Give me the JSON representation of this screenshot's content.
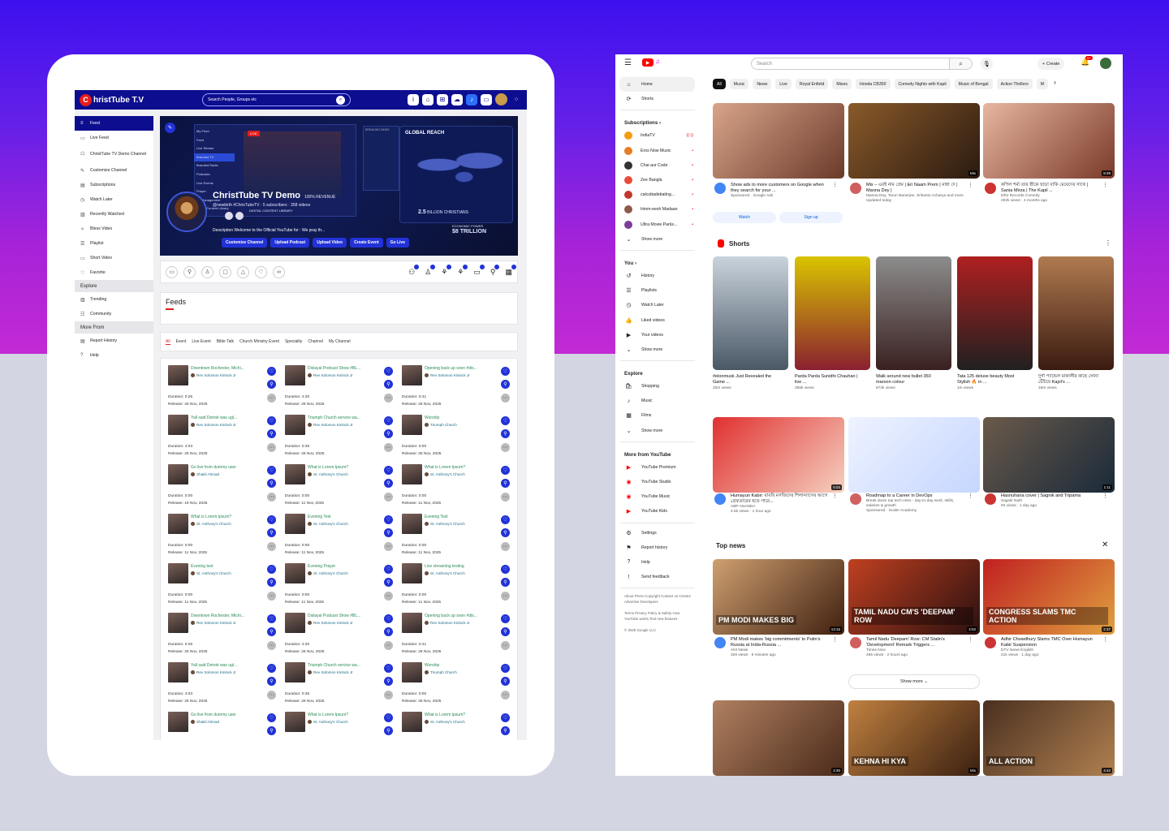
{
  "christtube": {
    "logo_letter": "C",
    "logo_text": "hristTube T.V",
    "search_placeholder": "Search People, Groups etc",
    "sidebar": {
      "items": [
        {
          "icon": "≡",
          "label": "Feed"
        },
        {
          "icon": "▭",
          "label": "Live Feed"
        },
        {
          "icon": "☖",
          "label": "ChristTube TV Demo Channel"
        },
        {
          "icon": "✎",
          "label": "Customize Channel"
        },
        {
          "icon": "▤",
          "label": "Subscriptions"
        },
        {
          "icon": "◷",
          "label": "Watch Later"
        },
        {
          "icon": "▥",
          "label": "Recently Watched"
        },
        {
          "icon": "✧",
          "label": "Bless Video"
        },
        {
          "icon": "☰",
          "label": "Playlist"
        },
        {
          "icon": "▭",
          "label": "Short Video"
        },
        {
          "icon": "♡",
          "label": "Favorite"
        }
      ],
      "explore_heading": "Explore",
      "explore_items": [
        {
          "icon": "▥",
          "label": "Trending"
        },
        {
          "icon": "☷",
          "label": "Community"
        }
      ],
      "more_heading": "More From",
      "more_items": [
        {
          "icon": "▤",
          "label": "Report History"
        },
        {
          "icon": "?",
          "label": "Help"
        }
      ]
    },
    "banner": {
      "menu": [
        "My Feed",
        "Feed",
        "Live Stream",
        "Branded TV",
        "Branded Radio",
        "Podcasts",
        "Live Events",
        "Prayer",
        "Ad Management",
        "Digital Content Library"
      ],
      "live": "LIVE",
      "breaking": "BREAKING NEWS",
      "global": "GLOBAL REACH",
      "revenue": "100% REVENUE",
      "stat1_value": "2.5",
      "stat1_label": "BILLION CHRISTIANS",
      "stat2_value": "$8 TRILLION",
      "stat2_label": "ECONOMIC POWER",
      "channel_title": "ChristTube TV Demo",
      "channel_sub": "@newbirth  #ChrisTubeTV · 5 subscribers · 358 videos",
      "library": "DIGITAL CONTENT LIBRARY",
      "description": "Description Welcome to the Official YouTube for : We pray th...",
      "buttons": [
        "Customize Channel",
        "Upload Podcast",
        "Upload Video",
        "Create Event",
        "Go Live"
      ]
    },
    "feeds_title": "Feeds",
    "tabs": [
      "All",
      "Event",
      "Live Event",
      "Bible Talk",
      "Church Ministry Event",
      "Speciality",
      "Channel",
      "My Channel"
    ],
    "cards": [
      {
        "title": "Downtown Rochester, Michi...",
        "author": "Rev Solomon Kinlock Jr",
        "duration": "Duration: 0:26",
        "release": "Release: 26 Nov, 2025"
      },
      {
        "title": "Dislayal Podcast Show #BL...",
        "author": "Rev Solomon Kinlock Jr",
        "duration": "Duration: 4:20",
        "release": "Release: 26 Nov, 2025"
      },
      {
        "title": "Opening back up soon #dis...",
        "author": "Rev Solomon Kinlock Jr",
        "duration": "Duration: 0:41",
        "release": "Release: 26 Nov, 2025"
      },
      {
        "title": "Yall said Detroit was ugl...",
        "author": "Rev Solomon Kinlock Jr",
        "duration": "Duration: 4:03",
        "release": "Release: 26 Nov, 2025"
      },
      {
        "title": "Triumph Church service wa...",
        "author": "Rev Solomon Kinlock Jr",
        "duration": "Duration: 0:36",
        "release": "Release: 26 Nov, 2025"
      },
      {
        "title": "Worship",
        "author": "Triumph Church",
        "duration": "Duration: 0:00",
        "release": "Release: 25 Nov, 2025"
      },
      {
        "title": "Go live from dummy user",
        "author": "Shakil Ahmad",
        "duration": "Duration: 0:00",
        "release": "Release: 19 Nov, 2025"
      },
      {
        "title": "What is Lorem Ipsum?",
        "author": "St. Anthony's Church",
        "duration": "Duration: 0:00",
        "release": "Release: 11 Nov, 2025"
      },
      {
        "title": "What is Lorem Ipsum?",
        "author": "St. Anthony's Church",
        "duration": "Duration: 0:00",
        "release": "Release: 11 Nov, 2025"
      },
      {
        "title": "What is Lorem Ipsum?",
        "author": "St. Anthony's Church",
        "duration": "Duration: 0:00",
        "release": "Release: 11 Nov, 2025"
      },
      {
        "title": "Evening Test",
        "author": "St. Anthony's Church",
        "duration": "Duration: 0:00",
        "release": "Release: 11 Nov, 2025"
      },
      {
        "title": "Evening Test",
        "author": "St. Anthony's Church",
        "duration": "Duration: 0:00",
        "release": "Release: 11 Nov, 2025"
      },
      {
        "title": "Evening test",
        "author": "St. Anthony's Church",
        "duration": "Duration: 0:00",
        "release": "Release: 11 Nov, 2025"
      },
      {
        "title": "Evening Prayer",
        "author": "St. Anthony's Church",
        "duration": "Duration: 0:00",
        "release": "Release: 11 Nov, 2025"
      },
      {
        "title": "Live streaming testing",
        "author": "St. Anthony's Church",
        "duration": "Duration: 0:00",
        "release": "Release: 11 Nov, 2025"
      },
      {
        "title": "Downtown Rochester, Michi...",
        "author": "Rev Solomon Kinlock Jr",
        "duration": "Duration: 0:26",
        "release": "Release: 26 Nov, 2025"
      },
      {
        "title": "Dislayal Podcast Show #BL...",
        "author": "Rev Solomon Kinlock Jr",
        "duration": "Duration: 4:20",
        "release": "Release: 26 Nov, 2025"
      },
      {
        "title": "Opening back up soon #dis...",
        "author": "Rev Solomon Kinlock Jr",
        "duration": "Duration: 0:41",
        "release": "Release: 26 Nov, 2025"
      },
      {
        "title": "Yall said Detroit was ugl...",
        "author": "Rev Solomon Kinlock Jr",
        "duration": "Duration: 4:03",
        "release": "Release: 26 Nov, 2025"
      },
      {
        "title": "Triumph Church service wa...",
        "author": "Rev Solomon Kinlock Jr",
        "duration": "Duration: 0:36",
        "release": "Release: 26 Nov, 2025"
      },
      {
        "title": "Worship",
        "author": "Triumph Church",
        "duration": "Duration: 0:00",
        "release": "Release: 25 Nov, 2025"
      },
      {
        "title": "Go live from dummy user",
        "author": "Shakil Ahmad",
        "duration": "",
        "release": ""
      },
      {
        "title": "What is Lorem Ipsum?",
        "author": "St. Anthony's Church",
        "duration": "",
        "release": ""
      },
      {
        "title": "What is Lorem Ipsum?",
        "author": "St. Anthony's Church",
        "duration": "",
        "release": ""
      }
    ]
  },
  "youtube": {
    "search_placeholder": "Search",
    "create_label": "+ Create",
    "bell_badge": "9+",
    "chips": [
      "All",
      "Music",
      "News",
      "Live",
      "Royal Enfield",
      "Mixes",
      "Honda CB350",
      "Comedy Nights with Kapil",
      "Music of Bengal",
      "Action Thrillers",
      "M"
    ],
    "sidebar": {
      "top": [
        {
          "icon": "⌂",
          "label": "Home"
        },
        {
          "icon": "⟳",
          "label": "Shorts"
        }
      ],
      "subs_heading": "Subscriptions  ›",
      "subs": [
        {
          "label": "IndiaTV",
          "color": "#f39c12",
          "live": "((·))"
        },
        {
          "label": "Eros Now Music",
          "color": "#e67e22",
          "live": "•"
        },
        {
          "label": "Chai aur Code",
          "color": "#333333",
          "live": "•"
        },
        {
          "label": "Zee Bangla",
          "color": "#e74c3c",
          "live": "•"
        },
        {
          "label": "calcuttadebating...",
          "color": "#c0392b",
          "live": "•"
        },
        {
          "label": "Hmm-eesh Madaan",
          "color": "#8e5a4a",
          "live": "•"
        },
        {
          "label": "Ultra Movie Parks...",
          "color": "#7d3c98",
          "live": "•"
        },
        {
          "label": "Show more",
          "color": "",
          "live": ""
        }
      ],
      "you_heading": "You  ›",
      "you": [
        {
          "icon": "↺",
          "label": "History"
        },
        {
          "icon": "☰",
          "label": "Playlists"
        },
        {
          "icon": "◷",
          "label": "Watch Later"
        },
        {
          "icon": "👍",
          "label": "Liked videos"
        },
        {
          "icon": "▶",
          "label": "Your videos"
        },
        {
          "icon": "⌄",
          "label": "Show more"
        }
      ],
      "explore_heading": "Explore",
      "explore": [
        {
          "icon": "🛍",
          "label": "Shopping"
        },
        {
          "icon": "♪",
          "label": "Music"
        },
        {
          "icon": "▦",
          "label": "Films"
        },
        {
          "icon": "⌄",
          "label": "Show more"
        }
      ],
      "more_heading": "More from YouTube",
      "more": [
        {
          "icon": "▶",
          "label": "YouTube Premium"
        },
        {
          "icon": "◉",
          "label": "YouTube Studio"
        },
        {
          "icon": "◉",
          "label": "YouTube Music"
        },
        {
          "icon": "▶",
          "label": "YouTube Kids"
        }
      ],
      "settings": [
        {
          "icon": "⚙",
          "label": "Settings"
        },
        {
          "icon": "⚑",
          "label": "Report history"
        },
        {
          "icon": "?",
          "label": "Help"
        },
        {
          "icon": "!",
          "label": "Send feedback"
        }
      ],
      "footer1": "About  Press  Copyright  Contact us  Creator  Advertise  Developers",
      "footer2": "Terms  Privacy  Policy & Safety  How YouTube works  Test new features",
      "copyright": "© 2025 Google LLC"
    },
    "row1": [
      {
        "title": "Show ads to more customers on Google when they search for your ...",
        "meta1": "Sponsored · Google Ads",
        "meta2": "",
        "dur": "",
        "bg": "linear-gradient(135deg,#d8a48a,#6b3a2a)"
      },
      {
        "title": "Mix – এরই নাম প্রেম | Eri Naam Prem | মান্না দে | Manna Dey |",
        "meta1": "Manna Dey, Tarun Banerjee, Srikanto Acharya and more",
        "meta2": "Updated today",
        "dur": "Mix",
        "bg": "linear-gradient(135deg,#8a5a2a,#2a1a10)"
      },
      {
        "title": "কপিল শর্মা তার স্ত্রীকে ছাড়া বাকি মেয়েদের সাথে | Sania Mirza | The Kapil ...",
        "meta1": "DRJ Records Comedy",
        "meta2": "292k views · 4 months ago",
        "dur": "8:39",
        "bg": "linear-gradient(135deg,#e7b6a0,#7a3a2a)"
      }
    ],
    "ad_buttons": [
      "Watch",
      "Sign up"
    ],
    "shorts_heading": "Shorts",
    "shorts": [
      {
        "title": "#elonmusk  Just Revealed the Game ...",
        "meta": "32m views",
        "bg": "linear-gradient(180deg,#c9d3dc,#4a5866)"
      },
      {
        "title": "Parda Parda Sunidhi Chauhan | live ...",
        "meta": "356k views",
        "bg": "linear-gradient(180deg,#d9c400,#8a2030)"
      },
      {
        "title": "Walk around new bullet 350 maroon colour",
        "meta": "872k views",
        "bg": "linear-gradient(180deg,#8c8c8c,#3a2020)"
      },
      {
        "title": "Tata 125 deluxe beauty Most Stylish 🔥 in ...",
        "meta": "1m views",
        "bg": "linear-gradient(180deg,#b02020,#202020)"
      },
      {
        "title": "দুর্গা প্যান্ডেল মাকালীর কাছে সোনা চেঁচিয়ে Kajol's ...",
        "meta": "18m views",
        "bg": "linear-gradient(180deg,#b07a50,#3a1a10)"
      }
    ],
    "row2": [
      {
        "title": "Humayun Kabir: বাবরি মসজিদের শিলান্যাসের আগে গ্রেফতারের হতে পারে...",
        "meta1": "ABP ANANDA",
        "meta2": "4.5k views · 1 hour ago",
        "dur": "5:03",
        "bg": "linear-gradient(135deg,#e03030,#f5d0c0)"
      },
      {
        "title": "Roadmap to a Career in DevOps",
        "meta1": "Break down top tech roles - day-to-day work, skills, salaries & growth",
        "meta2": "Sponsored · Scaler Academy",
        "dur": "",
        "bg": "linear-gradient(135deg,#eef3ff,#c6d6ff)"
      },
      {
        "title": "Hasnuhana cover | Sagnik and Tripama",
        "meta1": "Sagnik Nath",
        "meta2": "83 views · 1 day ago",
        "dur": "1:11",
        "bg": "linear-gradient(135deg,#6a5a4a,#1a2a3a)"
      }
    ],
    "news_heading": "Top news",
    "news": [
      {
        "title": "PM Modi makes 'big commitments' to Putin's Russia at India-Russia ...",
        "meta1": "ANI News",
        "meta2": "329 views · 9 minutes ago",
        "dur": "13:16",
        "bg": "linear-gradient(135deg,#cfa070,#402010)",
        "caption": "PM MODI MAKES BIG"
      },
      {
        "title": "Tamil Nadu 'Deepam' Row: CM Stalin's 'Development' Remark Triggers ...",
        "meta1": "Times Now",
        "meta2": "465 views · 2 hours ago",
        "dur": "4:02",
        "bg": "linear-gradient(135deg,#c04020,#2a1010)",
        "caption": "TAMIL NADU CM'S 'DEEPAM' ROW"
      },
      {
        "title": "Adhir Chowdhury Slams TMC Over Humayun Kabir Suspension",
        "meta1": "DTV News English",
        "meta2": "21k views · 1 day ago",
        "dur": "2:37",
        "bg": "linear-gradient(135deg,#c02020,#e0a040)",
        "caption": "CONGRESS SLAMS TMC ACTION"
      }
    ],
    "show_more": "Show more  ⌄",
    "row3": [
      {
        "dur": "2:30",
        "bg": "linear-gradient(135deg,#b08060,#4a2a1a)",
        "caption": ""
      },
      {
        "dur": "Mix",
        "bg": "linear-gradient(135deg,#c08040,#3a2010)",
        "caption": "KEHNA HI KYA"
      },
      {
        "dur": "4:42",
        "bg": "linear-gradient(135deg,#4a3020,#b08050)",
        "caption": "ALL ACTION"
      }
    ]
  }
}
